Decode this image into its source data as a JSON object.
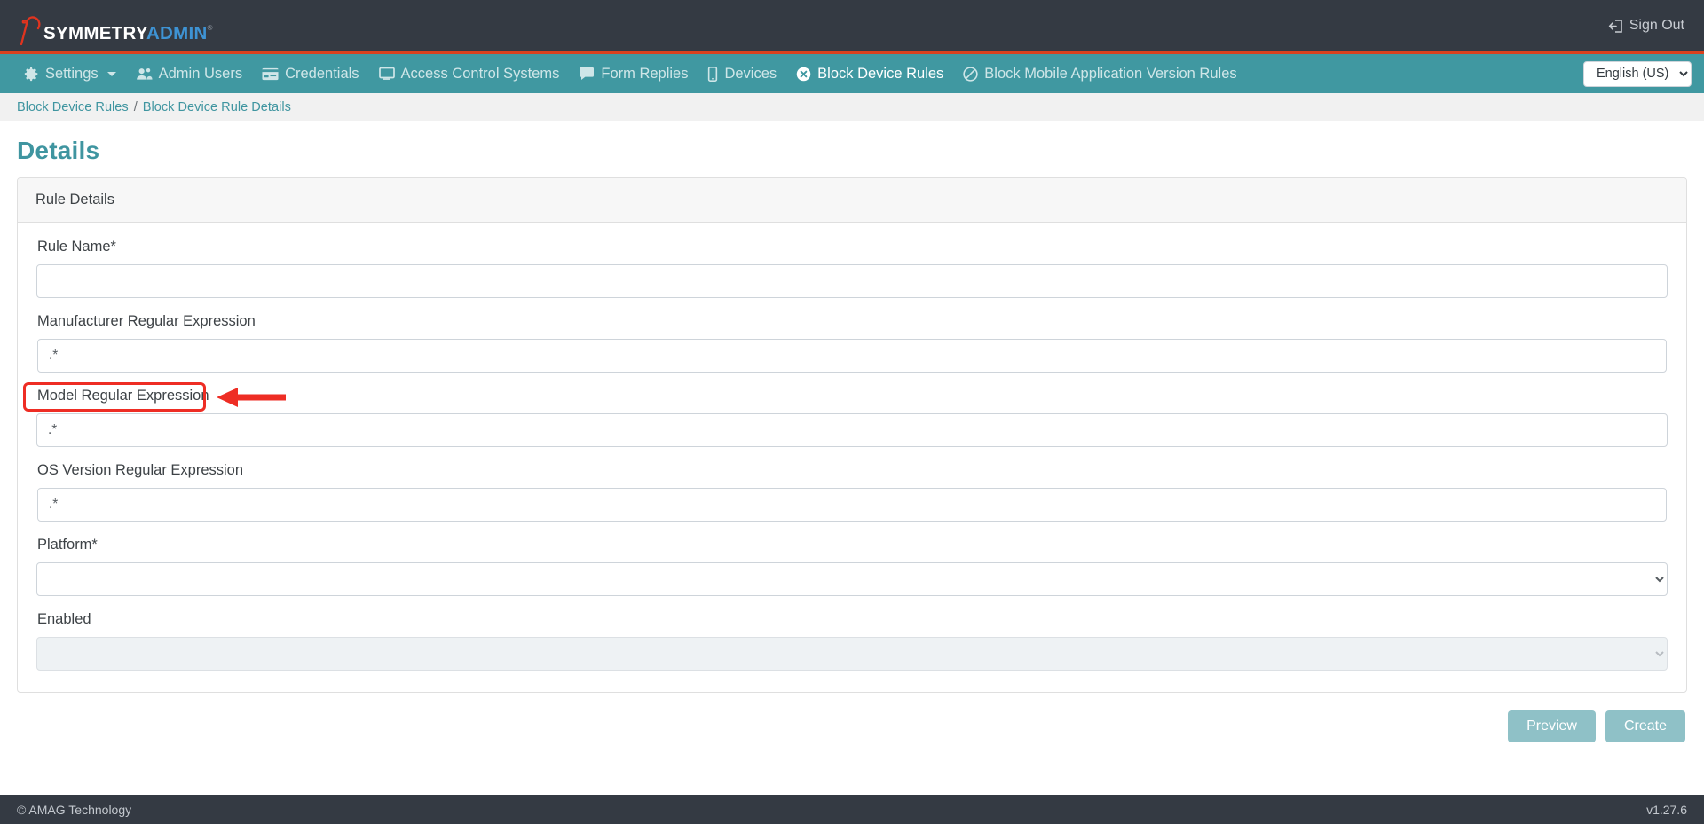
{
  "header": {
    "logo": {
      "primary": "SYMMETRY",
      "secondary": "ADMIN",
      "trademark": "®",
      "mark_icon": "symmetry-bird-mark"
    },
    "sign_out_label": "Sign Out",
    "sign_out_icon": "sign-out-icon",
    "accent_bar_color": "#d9411e",
    "background_color": "#343a43"
  },
  "nav": {
    "background_color": "#4098a1",
    "items": [
      {
        "label": "Settings",
        "icon": "gear-icon",
        "active": false,
        "has_caret": true
      },
      {
        "label": "Admin Users",
        "icon": "users-icon",
        "active": false,
        "has_caret": false
      },
      {
        "label": "Credentials",
        "icon": "card-icon",
        "active": false,
        "has_caret": false
      },
      {
        "label": "Access Control Systems",
        "icon": "monitor-icon",
        "active": false,
        "has_caret": false
      },
      {
        "label": "Form Replies",
        "icon": "comment-icon",
        "active": false,
        "has_caret": false
      },
      {
        "label": "Devices",
        "icon": "mobile-icon",
        "active": false,
        "has_caret": false
      },
      {
        "label": "Block Device Rules",
        "icon": "times-circle-icon",
        "active": true,
        "has_caret": false
      },
      {
        "label": "Block Mobile Application Version Rules",
        "icon": "ban-icon",
        "active": false,
        "has_caret": false
      }
    ],
    "language": {
      "selected": "English (US)",
      "options": [
        "English (US)"
      ],
      "icon": "chevron-down-icon"
    }
  },
  "breadcrumb": {
    "parent": "Block Device Rules",
    "separator": "/",
    "current": "Block Device Rule Details"
  },
  "page": {
    "title": "Details"
  },
  "card": {
    "header": "Rule Details",
    "fields": [
      {
        "label": "Rule Name*",
        "type": "text",
        "value": "",
        "placeholder": ""
      },
      {
        "label": "Manufacturer Regular Expression",
        "type": "text",
        "value": ".*",
        "placeholder": ""
      },
      {
        "label": "Model Regular Expression",
        "type": "text",
        "value": ".*",
        "placeholder": "",
        "highlighted": true
      },
      {
        "label": "OS Version Regular Expression",
        "type": "text",
        "value": ".*",
        "placeholder": ""
      },
      {
        "label": "Platform*",
        "type": "select",
        "value": "",
        "options": [
          ""
        ],
        "disabled": false
      },
      {
        "label": "Enabled",
        "type": "select",
        "value": "",
        "options": [
          ""
        ],
        "disabled": true
      }
    ]
  },
  "actions": {
    "preview_label": "Preview",
    "create_label": "Create",
    "button_color": "#8fc1c7"
  },
  "annotation": {
    "target_label": "Model Regular Expression",
    "shape": "rounded-rectangle-with-left-arrow",
    "color": "#ee2d24"
  },
  "footer": {
    "copyright": "© AMAG Technology",
    "version": "v1.27.6"
  }
}
